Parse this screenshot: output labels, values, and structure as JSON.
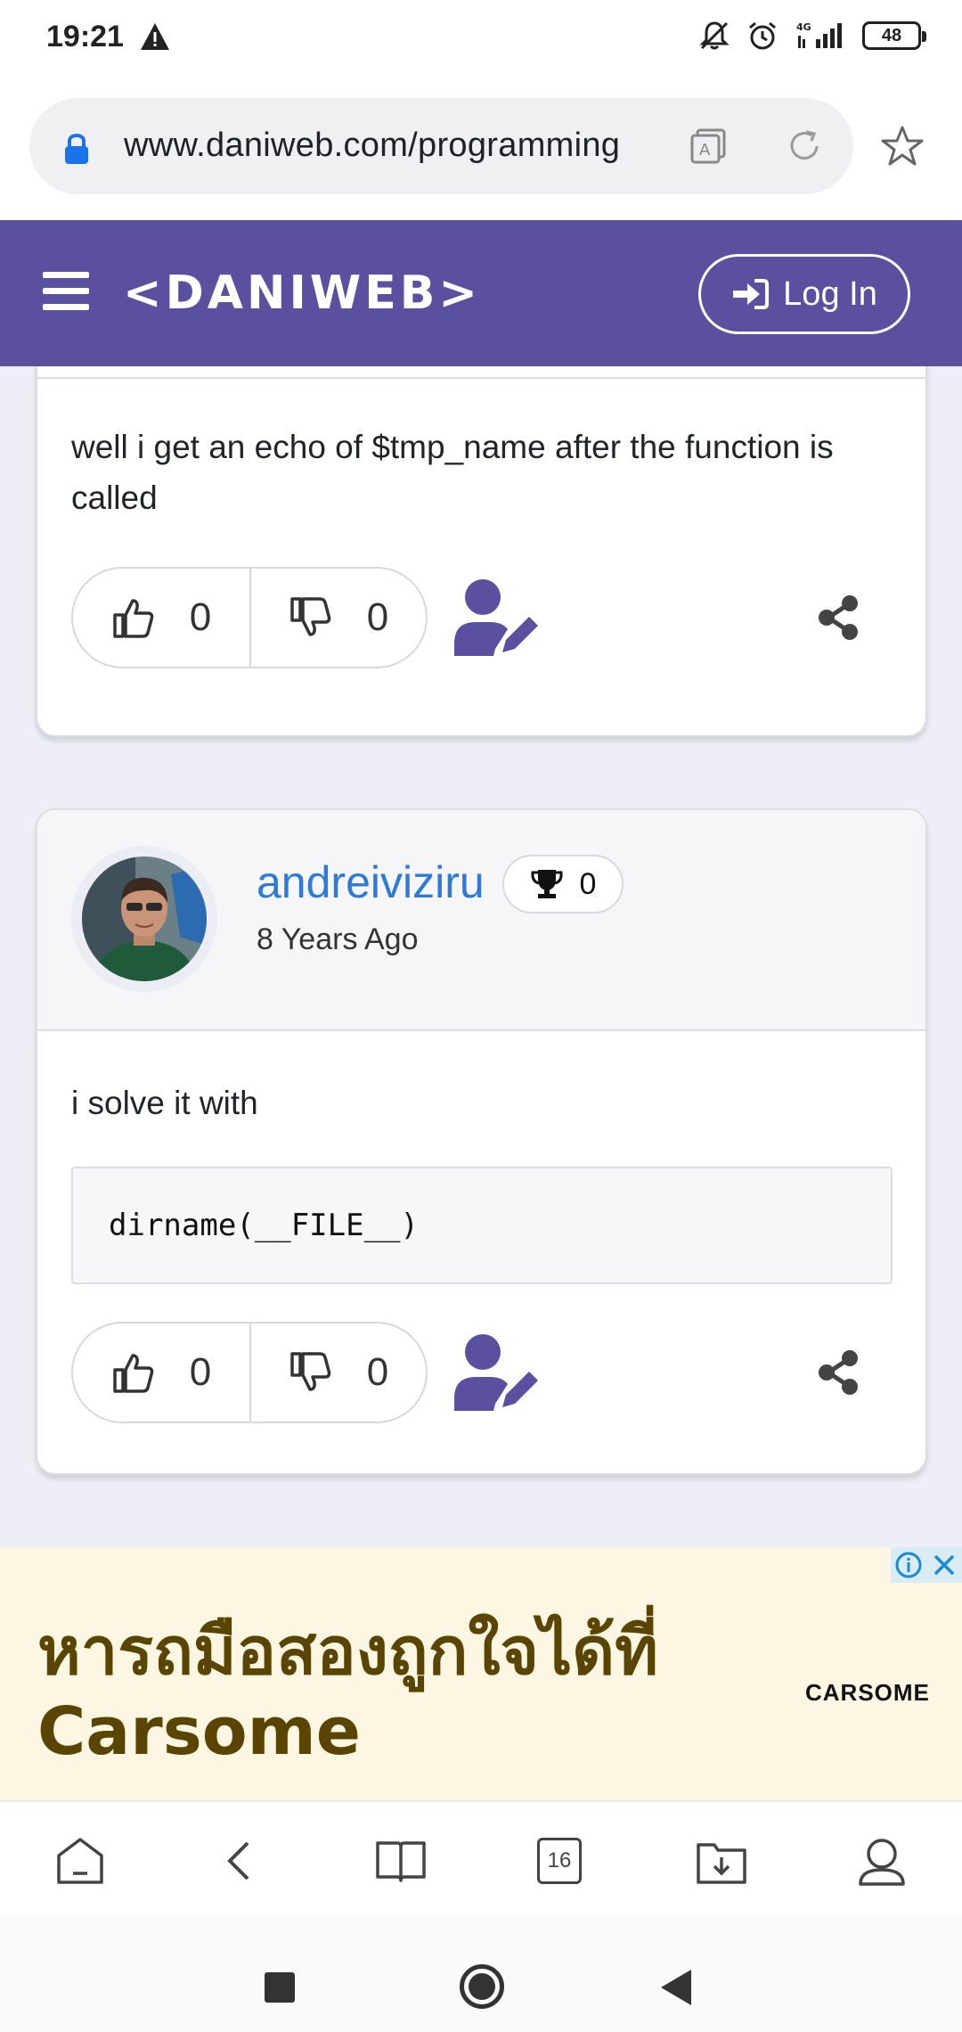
{
  "status_bar": {
    "time": "19:21",
    "network": "4G",
    "battery": "48"
  },
  "browser": {
    "url": "www.daniweb.com/programming",
    "tab_count": "16"
  },
  "site_header": {
    "logo": "<DANIWEB>",
    "login_label": "Log In",
    "brand_color": "#5b4fa0"
  },
  "posts": [
    {
      "text": "well i get an echo of $tmp_name after the function is called",
      "upvotes": "0",
      "downvotes": "0"
    },
    {
      "author": "andreiviziru",
      "reputation": "0",
      "posted_ago": "8 Years Ago",
      "text": "i solve it with",
      "code": "dirname(__FILE__)",
      "upvotes": "0",
      "downvotes": "0"
    }
  ],
  "ad": {
    "headline_line1": "หารถมือสองถูกใจได้ที่",
    "headline_line2": "Carsome",
    "brand": "CARSOME"
  }
}
